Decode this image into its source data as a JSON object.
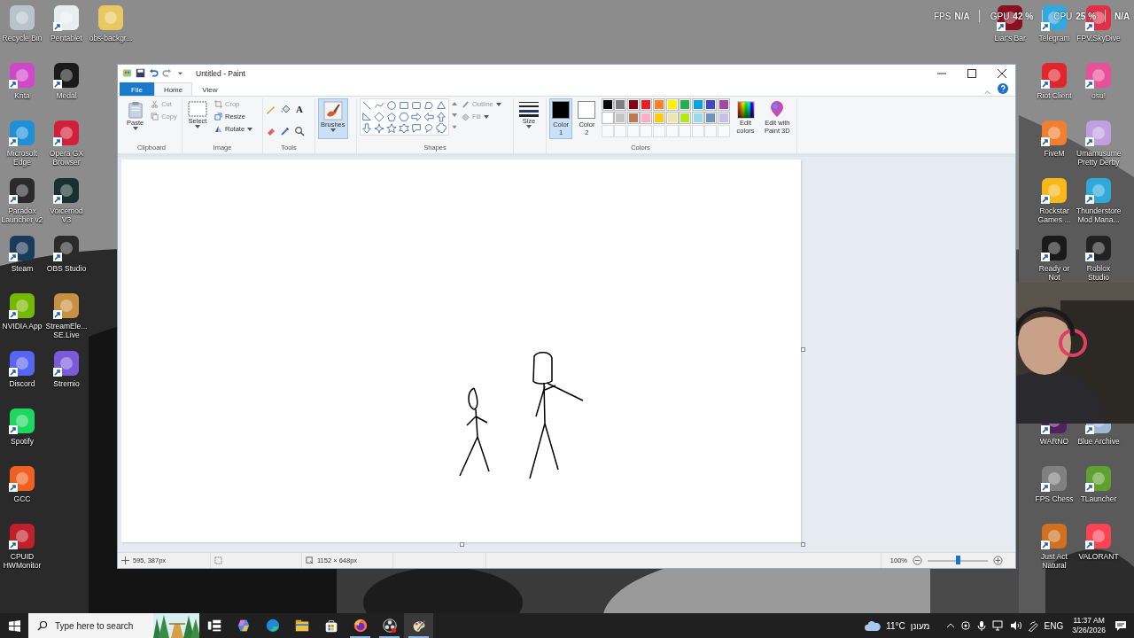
{
  "desktop": {
    "left_columns": [
      [
        {
          "label": "Recycle Bin",
          "color": "#b8c4cc",
          "shortcut": false
        },
        {
          "label": "Krita",
          "color": "#d048c8",
          "shortcut": true
        },
        {
          "label": "Microsoft Edge",
          "color": "#1f8fd8",
          "shortcut": true
        },
        {
          "label": "Paradox Launcher v2",
          "color": "#2a2a2a",
          "shortcut": true
        },
        {
          "label": "Steam",
          "color": "#1b3a5c",
          "shortcut": true
        },
        {
          "label": "NVIDIA App",
          "color": "#76b900",
          "shortcut": true
        },
        {
          "label": "Discord",
          "color": "#5865f2",
          "shortcut": true
        },
        {
          "label": "Spotify",
          "color": "#1ed760",
          "shortcut": true
        },
        {
          "label": "GCC",
          "color": "#f06020",
          "shortcut": true
        },
        {
          "label": "CPUID HWMonitor",
          "color": "#c0202a",
          "shortcut": true
        }
      ],
      [
        {
          "label": "Pentablet",
          "color": "#e8eef0",
          "shortcut": true
        },
        {
          "label": "Medal",
          "color": "#1a1a1a",
          "shortcut": true
        },
        {
          "label": "Opera GX Browser",
          "color": "#d0203c",
          "shortcut": true
        },
        {
          "label": "Voicemod V3",
          "color": "#18302f",
          "shortcut": true
        },
        {
          "label": "OBS Studio",
          "color": "#2b2b2b",
          "shortcut": true
        },
        {
          "label": "StreamEle... SE.Live",
          "color": "#c89040",
          "shortcut": true
        },
        {
          "label": "Stremio",
          "color": "#7b5bd8",
          "shortcut": true
        }
      ],
      [
        {
          "label": "obs-backgr...",
          "color": "#e8c860",
          "shortcut": false
        }
      ]
    ],
    "right_columns": [
      {
        "upper": [
          {
            "label": "Liar's Bar",
            "color": "#8a1020",
            "shortcut": true
          }
        ]
      },
      {
        "upper": [
          {
            "label": "Telegram",
            "color": "#30a8e0",
            "shortcut": true
          },
          {
            "label": "Riot Client",
            "color": "#e0252c",
            "shortcut": true
          },
          {
            "label": "FiveM",
            "color": "#f08030",
            "shortcut": true
          },
          {
            "label": "Rockstar Games ...",
            "color": "#f8b818",
            "shortcut": true
          },
          {
            "label": "Ready or Not",
            "color": "#1a1a1a",
            "shortcut": true
          }
        ],
        "lower": [
          {
            "label": "WARNO",
            "color": "#502060",
            "shortcut": true
          },
          {
            "label": "FPS Chess",
            "color": "#808080",
            "shortcut": true
          },
          {
            "label": "Just Act Natural",
            "color": "#d07020",
            "shortcut": true
          }
        ]
      },
      {
        "upper": [
          {
            "label": "FPV.SkyDive",
            "color": "#e03048",
            "shortcut": true
          },
          {
            "label": "osu!",
            "color": "#e8509a",
            "shortcut": true
          },
          {
            "label": "Umamusume Pretty Derby",
            "color": "#c0a0e0",
            "shortcut": true
          },
          {
            "label": "Thunderstore Mod Mana...",
            "color": "#30a8d8",
            "shortcut": true
          },
          {
            "label": "Roblox Studio",
            "color": "#222222",
            "shortcut": true
          }
        ],
        "lower": [
          {
            "label": "Blue Archive",
            "color": "#a0b8d8",
            "shortcut": true
          },
          {
            "label": "TLauncher",
            "color": "#60a030",
            "shortcut": true
          },
          {
            "label": "VALORANT",
            "color": "#fa4454",
            "shortcut": true
          }
        ]
      }
    ]
  },
  "overlay_stats": [
    {
      "label": "FPS",
      "value": "N/A"
    },
    {
      "label": "GPU",
      "value": "42 %"
    },
    {
      "label": "CPU",
      "value": "25 %"
    },
    {
      "value": "N/A"
    }
  ],
  "paint": {
    "title": "Untitled - Paint",
    "file_menu": "File",
    "tabs": [
      {
        "label": "Home",
        "selected": true
      },
      {
        "label": "View",
        "selected": false
      }
    ],
    "clipboard": {
      "label": "Clipboard",
      "paste": "Paste",
      "items": [
        {
          "label": "Cut",
          "kind": "cut",
          "disabled": true
        },
        {
          "label": "Copy",
          "kind": "copy",
          "disabled": true
        }
      ]
    },
    "image": {
      "label": "Image",
      "select": "Select",
      "items": [
        {
          "label": "Crop",
          "kind": "crop",
          "disabled": true
        },
        {
          "label": "Resize",
          "kind": "resize",
          "disabled": false
        },
        {
          "label": "Rotate",
          "kind": "rotate",
          "disabled": false
        }
      ]
    },
    "tools": {
      "label": "Tools",
      "items": [
        {
          "kind": "pencil"
        },
        {
          "kind": "fill"
        },
        {
          "kind": "text",
          "glyph": "A"
        },
        {
          "kind": "eraser"
        },
        {
          "kind": "picker"
        },
        {
          "kind": "magnifier"
        }
      ]
    },
    "brushes": {
      "label": "Brushes",
      "selected": true
    },
    "shapes": {
      "label": "Shapes",
      "outline": "Outline",
      "fill": "Fill"
    },
    "size": {
      "label": "Size"
    },
    "color_slots": [
      {
        "label": "Color",
        "number": "1",
        "color": "#000000",
        "selected": true
      },
      {
        "label": "Color",
        "number": "2",
        "color": "#ffffff",
        "selected": false
      }
    ],
    "palette": [
      {
        "color": "#000000"
      },
      {
        "color": "#7f7f7f"
      },
      {
        "color": "#880015"
      },
      {
        "color": "#ed1c24"
      },
      {
        "color": "#ff7f27"
      },
      {
        "color": "#fff200"
      },
      {
        "color": "#22b14c"
      },
      {
        "color": "#00a2e8"
      },
      {
        "color": "#3f48cc"
      },
      {
        "color": "#a349a4"
      },
      {
        "color": "#ffffff"
      },
      {
        "color": "#c3c3c3"
      },
      {
        "color": "#b97a57"
      },
      {
        "color": "#ffaec9"
      },
      {
        "color": "#ffc90e"
      },
      {
        "color": "#efe4b0"
      },
      {
        "color": "#b5e61d"
      },
      {
        "color": "#99d9ea"
      },
      {
        "color": "#7092be"
      },
      {
        "color": "#c8bfe7"
      }
    ],
    "colors_label": "Colors",
    "edit_colors": "Edit colors",
    "paint3d": "Edit with Paint 3D",
    "status": {
      "position": "595, 387px",
      "dimensions": "1152 × 648px",
      "zoom": "100%",
      "zoom_slider": {
        "level": 0.5
      }
    }
  },
  "taskbar": {
    "search": {
      "placeholder": "Type here to search"
    },
    "apps": [
      {
        "kind": "task-view",
        "running": false,
        "selected": false
      },
      {
        "kind": "copilot",
        "running": false,
        "selected": false
      },
      {
        "kind": "edge",
        "running": false,
        "selected": false
      },
      {
        "kind": "explorer",
        "running": false,
        "selected": false
      },
      {
        "kind": "store",
        "running": false,
        "selected": false
      },
      {
        "kind": "firefox",
        "running": true,
        "selected": false
      },
      {
        "kind": "obs",
        "running": true,
        "selected": false
      },
      {
        "kind": "paint",
        "running": true,
        "selected": true
      }
    ],
    "weather": {
      "temperature": "11°C",
      "condition": "מעונן"
    },
    "language": "ENG",
    "time": "11:37 AM",
    "date": "3/26/2026"
  }
}
